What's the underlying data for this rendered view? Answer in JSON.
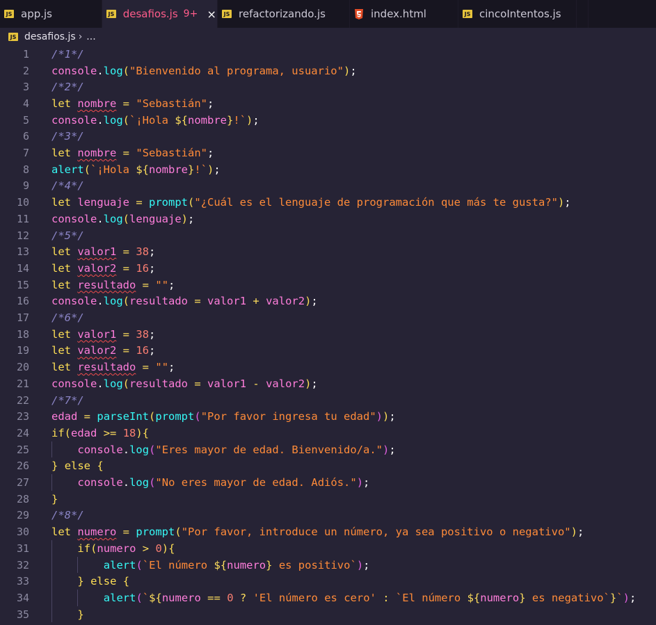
{
  "tabs": [
    {
      "name": "app.js",
      "icon": "js-icon",
      "active": false,
      "width": 147
    },
    {
      "name": "desafios.js",
      "icon": "js-icon",
      "active": true,
      "badge": "9+",
      "close": "×",
      "width": 166
    },
    {
      "name": "refactorizando.js",
      "icon": "js-icon",
      "active": false,
      "width": 190
    },
    {
      "name": "index.html",
      "icon": "html-icon",
      "active": false,
      "width": 156
    },
    {
      "name": "cincoIntentos.js",
      "icon": "js-icon",
      "active": false,
      "width": 170
    }
  ],
  "breadcrumb": {
    "file": "desafios.js",
    "more": "..."
  },
  "colors": {
    "background": "#262335",
    "tabbar": "#171520",
    "active_tab_text": "#fe5c8a"
  },
  "code_lines": [
    {
      "n": "1",
      "indent": 0,
      "tokens": [
        [
          "c",
          "/*1*/"
        ]
      ]
    },
    {
      "n": "2",
      "indent": 0,
      "tokens": [
        [
          "v",
          "console"
        ],
        [
          "p",
          "."
        ],
        [
          "f",
          "log"
        ],
        [
          "p1",
          "("
        ],
        [
          "s",
          "\"Bienvenido al programa, usuario\""
        ],
        [
          "p1",
          ")"
        ],
        [
          "p",
          ";"
        ]
      ]
    },
    {
      "n": "3",
      "indent": 0,
      "tokens": [
        [
          "c",
          "/*2*/"
        ]
      ]
    },
    {
      "n": "4",
      "indent": 0,
      "tokens": [
        [
          "k",
          "let "
        ],
        [
          "vs",
          "nombre"
        ],
        [
          "p",
          " "
        ],
        [
          "o",
          "="
        ],
        [
          "p",
          " "
        ],
        [
          "s",
          "\"Sebastián\""
        ],
        [
          "p",
          ";"
        ]
      ]
    },
    {
      "n": "5",
      "indent": 0,
      "tokens": [
        [
          "v",
          "console"
        ],
        [
          "p",
          "."
        ],
        [
          "f",
          "log"
        ],
        [
          "p1",
          "("
        ],
        [
          "s",
          "`¡Hola "
        ],
        [
          "i",
          "${"
        ],
        [
          "v",
          "nombre"
        ],
        [
          "i",
          "}"
        ],
        [
          "s",
          "!`"
        ],
        [
          "p1",
          ")"
        ],
        [
          "p",
          ";"
        ]
      ]
    },
    {
      "n": "6",
      "indent": 0,
      "tokens": [
        [
          "c",
          "/*3*/"
        ]
      ]
    },
    {
      "n": "7",
      "indent": 0,
      "tokens": [
        [
          "k",
          "let "
        ],
        [
          "vs",
          "nombre"
        ],
        [
          "p",
          " "
        ],
        [
          "o",
          "="
        ],
        [
          "p",
          " "
        ],
        [
          "s",
          "\"Sebastián\""
        ],
        [
          "p",
          ";"
        ]
      ]
    },
    {
      "n": "8",
      "indent": 0,
      "tokens": [
        [
          "f",
          "alert"
        ],
        [
          "p1",
          "("
        ],
        [
          "s",
          "`¡Hola "
        ],
        [
          "i",
          "${"
        ],
        [
          "v",
          "nombre"
        ],
        [
          "i",
          "}"
        ],
        [
          "s",
          "!`"
        ],
        [
          "p1",
          ")"
        ],
        [
          "p",
          ";"
        ]
      ]
    },
    {
      "n": "9",
      "indent": 0,
      "tokens": [
        [
          "c",
          "/*4*/"
        ]
      ]
    },
    {
      "n": "10",
      "indent": 0,
      "tokens": [
        [
          "k",
          "let "
        ],
        [
          "v",
          "lenguaje"
        ],
        [
          "p",
          " "
        ],
        [
          "o",
          "="
        ],
        [
          "p",
          " "
        ],
        [
          "f",
          "prompt"
        ],
        [
          "p1",
          "("
        ],
        [
          "s",
          "\"¿Cuál es el lenguaje de programación que más te gusta?\""
        ],
        [
          "p1",
          ")"
        ],
        [
          "p",
          ";"
        ]
      ]
    },
    {
      "n": "11",
      "indent": 0,
      "tokens": [
        [
          "v",
          "console"
        ],
        [
          "p",
          "."
        ],
        [
          "f",
          "log"
        ],
        [
          "p1",
          "("
        ],
        [
          "v",
          "lenguaje"
        ],
        [
          "p1",
          ")"
        ],
        [
          "p",
          ";"
        ]
      ]
    },
    {
      "n": "12",
      "indent": 0,
      "tokens": [
        [
          "c",
          "/*5*/"
        ]
      ]
    },
    {
      "n": "13",
      "indent": 0,
      "tokens": [
        [
          "k",
          "let "
        ],
        [
          "vs",
          "valor1"
        ],
        [
          "p",
          " "
        ],
        [
          "o",
          "="
        ],
        [
          "p",
          " "
        ],
        [
          "n",
          "38"
        ],
        [
          "p",
          ";"
        ]
      ]
    },
    {
      "n": "14",
      "indent": 0,
      "tokens": [
        [
          "k",
          "let "
        ],
        [
          "vs",
          "valor2"
        ],
        [
          "p",
          " "
        ],
        [
          "o",
          "="
        ],
        [
          "p",
          " "
        ],
        [
          "n",
          "16"
        ],
        [
          "p",
          ";"
        ]
      ]
    },
    {
      "n": "15",
      "indent": 0,
      "tokens": [
        [
          "k",
          "let "
        ],
        [
          "vs",
          "resultado"
        ],
        [
          "p",
          " "
        ],
        [
          "o",
          "="
        ],
        [
          "p",
          " "
        ],
        [
          "s",
          "\"\""
        ],
        [
          "p",
          ";"
        ]
      ]
    },
    {
      "n": "16",
      "indent": 0,
      "tokens": [
        [
          "v",
          "console"
        ],
        [
          "p",
          "."
        ],
        [
          "f",
          "log"
        ],
        [
          "p1",
          "("
        ],
        [
          "v",
          "resultado"
        ],
        [
          "p",
          " "
        ],
        [
          "o",
          "="
        ],
        [
          "p",
          " "
        ],
        [
          "v",
          "valor1"
        ],
        [
          "p",
          " "
        ],
        [
          "o",
          "+"
        ],
        [
          "p",
          " "
        ],
        [
          "v",
          "valor2"
        ],
        [
          "p1",
          ")"
        ],
        [
          "p",
          ";"
        ]
      ]
    },
    {
      "n": "17",
      "indent": 0,
      "tokens": [
        [
          "c",
          "/*6*/"
        ]
      ]
    },
    {
      "n": "18",
      "indent": 0,
      "tokens": [
        [
          "k",
          "let "
        ],
        [
          "vs",
          "valor1"
        ],
        [
          "p",
          " "
        ],
        [
          "o",
          "="
        ],
        [
          "p",
          " "
        ],
        [
          "n",
          "38"
        ],
        [
          "p",
          ";"
        ]
      ]
    },
    {
      "n": "19",
      "indent": 0,
      "tokens": [
        [
          "k",
          "let "
        ],
        [
          "vs",
          "valor2"
        ],
        [
          "p",
          " "
        ],
        [
          "o",
          "="
        ],
        [
          "p",
          " "
        ],
        [
          "n",
          "16"
        ],
        [
          "p",
          ";"
        ]
      ]
    },
    {
      "n": "20",
      "indent": 0,
      "tokens": [
        [
          "k",
          "let "
        ],
        [
          "vs",
          "resultado"
        ],
        [
          "p",
          " "
        ],
        [
          "o",
          "="
        ],
        [
          "p",
          " "
        ],
        [
          "s",
          "\"\""
        ],
        [
          "p",
          ";"
        ]
      ]
    },
    {
      "n": "21",
      "indent": 0,
      "tokens": [
        [
          "v",
          "console"
        ],
        [
          "p",
          "."
        ],
        [
          "f",
          "log"
        ],
        [
          "p1",
          "("
        ],
        [
          "v",
          "resultado"
        ],
        [
          "p",
          " "
        ],
        [
          "o",
          "="
        ],
        [
          "p",
          " "
        ],
        [
          "v",
          "valor1"
        ],
        [
          "p",
          " "
        ],
        [
          "o",
          "-"
        ],
        [
          "p",
          " "
        ],
        [
          "v",
          "valor2"
        ],
        [
          "p1",
          ")"
        ],
        [
          "p",
          ";"
        ]
      ]
    },
    {
      "n": "22",
      "indent": 0,
      "tokens": [
        [
          "c",
          "/*7*/"
        ]
      ]
    },
    {
      "n": "23",
      "indent": 0,
      "tokens": [
        [
          "v",
          "edad"
        ],
        [
          "p",
          " "
        ],
        [
          "o",
          "="
        ],
        [
          "p",
          " "
        ],
        [
          "f",
          "parseInt"
        ],
        [
          "p1",
          "("
        ],
        [
          "f",
          "prompt"
        ],
        [
          "p2",
          "("
        ],
        [
          "s",
          "\"Por favor ingresa tu edad\""
        ],
        [
          "p2",
          ")"
        ],
        [
          "p1",
          ")"
        ],
        [
          "p",
          ";"
        ]
      ]
    },
    {
      "n": "24",
      "indent": 0,
      "tokens": [
        [
          "k",
          "if"
        ],
        [
          "p1",
          "("
        ],
        [
          "v",
          "edad"
        ],
        [
          "p",
          " "
        ],
        [
          "o",
          ">="
        ],
        [
          "p",
          " "
        ],
        [
          "n",
          "18"
        ],
        [
          "p1",
          ")"
        ],
        [
          "p1",
          "{"
        ]
      ]
    },
    {
      "n": "25",
      "indent": 1,
      "tokens": [
        [
          "v",
          "console"
        ],
        [
          "p",
          "."
        ],
        [
          "f",
          "log"
        ],
        [
          "p2",
          "("
        ],
        [
          "s",
          "\"Eres mayor de edad. Bienvenido/a.\""
        ],
        [
          "p2",
          ")"
        ],
        [
          "p",
          ";"
        ]
      ]
    },
    {
      "n": "26",
      "indent": 0,
      "tokens": [
        [
          "p1",
          "}"
        ],
        [
          "p",
          " "
        ],
        [
          "k",
          "else"
        ],
        [
          "p",
          " "
        ],
        [
          "p1",
          "{"
        ]
      ]
    },
    {
      "n": "27",
      "indent": 1,
      "tokens": [
        [
          "v",
          "console"
        ],
        [
          "p",
          "."
        ],
        [
          "f",
          "log"
        ],
        [
          "p2",
          "("
        ],
        [
          "s",
          "\"No eres mayor de edad. Adiós.\""
        ],
        [
          "p2",
          ")"
        ],
        [
          "p",
          ";"
        ]
      ]
    },
    {
      "n": "28",
      "indent": 0,
      "tokens": [
        [
          "p1",
          "}"
        ]
      ]
    },
    {
      "n": "29",
      "indent": 0,
      "tokens": [
        [
          "c",
          "/*8*/"
        ]
      ]
    },
    {
      "n": "30",
      "indent": 0,
      "tokens": [
        [
          "k",
          "let "
        ],
        [
          "vs",
          "numero"
        ],
        [
          "p",
          " "
        ],
        [
          "o",
          "="
        ],
        [
          "p",
          " "
        ],
        [
          "f",
          "prompt"
        ],
        [
          "p1",
          "("
        ],
        [
          "s",
          "\"Por favor, introduce un número, ya sea positivo o negativo\""
        ],
        [
          "p1",
          ")"
        ],
        [
          "p",
          ";"
        ]
      ]
    },
    {
      "n": "31",
      "indent": 1,
      "tokens": [
        [
          "k",
          "if"
        ],
        [
          "p1",
          "("
        ],
        [
          "v",
          "numero"
        ],
        [
          "p",
          " "
        ],
        [
          "o",
          ">"
        ],
        [
          "p",
          " "
        ],
        [
          "n",
          "0"
        ],
        [
          "p1",
          ")"
        ],
        [
          "p1",
          "{"
        ]
      ]
    },
    {
      "n": "32",
      "indent": 2,
      "tokens": [
        [
          "f",
          "alert"
        ],
        [
          "p2",
          "("
        ],
        [
          "s",
          "`El número "
        ],
        [
          "i",
          "${"
        ],
        [
          "v",
          "numero"
        ],
        [
          "i",
          "}"
        ],
        [
          "s",
          " es positivo`"
        ],
        [
          "p2",
          ")"
        ],
        [
          "p",
          ";"
        ]
      ]
    },
    {
      "n": "33",
      "indent": 1,
      "tokens": [
        [
          "p1",
          "}"
        ],
        [
          "p",
          " "
        ],
        [
          "k",
          "else"
        ],
        [
          "p",
          " "
        ],
        [
          "p1",
          "{"
        ]
      ]
    },
    {
      "n": "34",
      "indent": 2,
      "tokens": [
        [
          "f",
          "alert"
        ],
        [
          "p2",
          "("
        ],
        [
          "s",
          "`"
        ],
        [
          "i",
          "${"
        ],
        [
          "v",
          "numero"
        ],
        [
          "p",
          " "
        ],
        [
          "o",
          "=="
        ],
        [
          "p",
          " "
        ],
        [
          "n",
          "0"
        ],
        [
          "p",
          " "
        ],
        [
          "o",
          "?"
        ],
        [
          "p",
          " "
        ],
        [
          "s",
          "'El número es cero'"
        ],
        [
          "p",
          " "
        ],
        [
          "o",
          ":"
        ],
        [
          "p",
          " "
        ],
        [
          "s",
          "`El número "
        ],
        [
          "i",
          "${"
        ],
        [
          "v",
          "numero"
        ],
        [
          "i",
          "}"
        ],
        [
          "s",
          " es negativo`"
        ],
        [
          "i",
          "}"
        ],
        [
          "s",
          "`"
        ],
        [
          "p2",
          ")"
        ],
        [
          "p",
          ";"
        ]
      ]
    },
    {
      "n": "35",
      "indent": 1,
      "tokens": [
        [
          "p1",
          "}"
        ]
      ]
    }
  ]
}
